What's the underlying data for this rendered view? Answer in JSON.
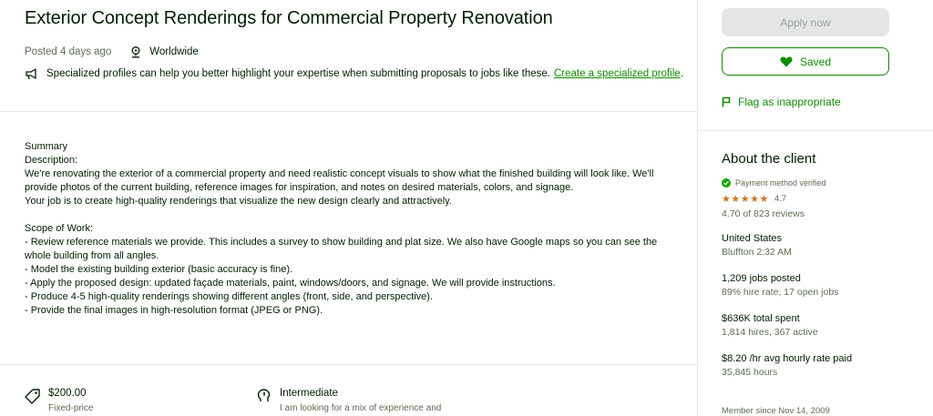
{
  "job": {
    "title": "Exterior Concept Renderings for Commercial Property Renovation",
    "posted": "Posted 4 days ago",
    "location": "Worldwide",
    "tip_text": "Specialized profiles can help you better highlight your expertise when submitting proposals to jobs like these.",
    "tip_link": "Create a specialized profile",
    "tip_end": "."
  },
  "description": {
    "lines": [
      "Summary",
      "Description:",
      "We're renovating the exterior of a commercial property and need realistic concept visuals to show what the finished building will look like. We'll",
      "provide photos of the current building, reference images for inspiration, and notes on desired materials, colors, and signage.",
      "Your job is to create high-quality renderings that visualize the new design clearly and attractively.",
      "",
      "Scope of Work:",
      "- Review reference materials we provide. This includes a survey to show building and plat size. We also have Google maps so you can see the",
      "whole building from all angles.",
      "- Model the existing building exterior (basic accuracy is fine).",
      "- Apply the proposed design: updated façade materials, paint, windows/doors, and signage. We will provide instructions.",
      "- Produce 4-5 high-quality renderings showing different angles (front, side, and perspective).",
      "- Provide the final images in high-resolution format (JPEG or PNG)."
    ]
  },
  "budget": {
    "value": "$200.00",
    "type": "Fixed-price"
  },
  "level": {
    "value": "Intermediate",
    "desc": "I am looking for a mix of experience and"
  },
  "sidebar": {
    "apply_label": "Apply now",
    "saved_label": "Saved",
    "flag_label": "Flag as inappropriate",
    "about_title": "About the client",
    "payment": "Payment method verified",
    "stars": "★★★★★",
    "rating": "4.7",
    "reviews": "4.70 of 823 reviews",
    "country": "United States",
    "city_time": "Bluffton 2:32 AM",
    "jobs_posted": "1,209 jobs posted",
    "hire_rate": "89% hire rate, 17 open jobs",
    "total_spent": "$636K total spent",
    "hires": "1,814 hires, 367 active",
    "avg_rate": "$8.20 /hr avg hourly rate paid",
    "hours": "35,845 hours",
    "member_since": "Member since Nov 14, 2009"
  },
  "colors": {
    "accent": "#108a00",
    "text": "#001e00",
    "muted": "#5e6d55",
    "star": "#d4731f"
  }
}
